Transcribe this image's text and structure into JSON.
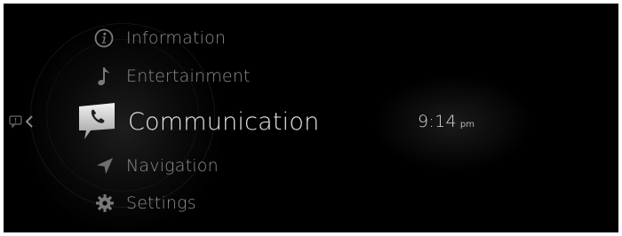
{
  "menu": {
    "items": [
      {
        "label": "Information",
        "icon": "info-icon",
        "active": false
      },
      {
        "label": "Entertainment",
        "icon": "music-note-icon",
        "active": false
      },
      {
        "label": "Communication",
        "icon": "phone-icon",
        "active": true
      },
      {
        "label": "Navigation",
        "icon": "navigation-arrow-icon",
        "active": false
      },
      {
        "label": "Settings",
        "icon": "gear-icon",
        "active": false
      }
    ]
  },
  "clock": {
    "time": "9:14",
    "ampm": "pm"
  },
  "back": {
    "icon": "notification-back-icon"
  },
  "colors": {
    "background": "#000000",
    "active_text": "#e8e8e8",
    "inactive_text": "#8e8e8e"
  }
}
